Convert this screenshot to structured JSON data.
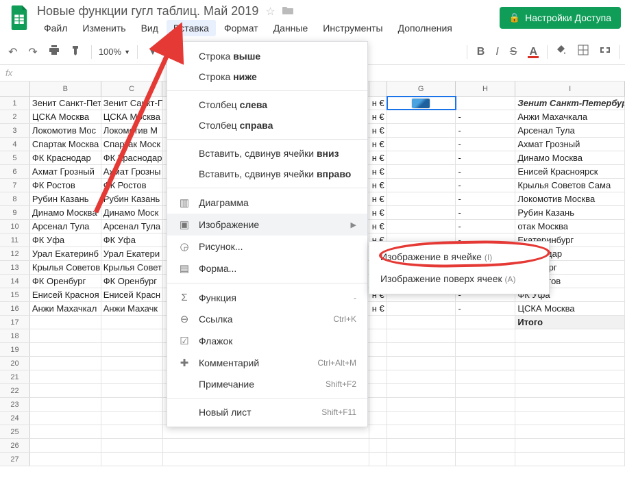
{
  "doc": {
    "title": "Новые функции гугл таблиц. Май 2019"
  },
  "menus": {
    "file": "Файл",
    "edit": "Изменить",
    "view": "Вид",
    "insert": "Вставка",
    "format": "Формат",
    "data": "Данные",
    "tools": "Инструменты",
    "addons": "Дополнения"
  },
  "share": {
    "label": "Настройки Доступа"
  },
  "toolbar": {
    "zoom": "100%",
    "bold": "B",
    "italic": "I",
    "strike": "S",
    "textcolor": "A"
  },
  "fx": {
    "label": "fx"
  },
  "columns": {
    "B": "B",
    "C": "C",
    "G": "G",
    "H": "H",
    "I": "I"
  },
  "insert_menu": {
    "row_above": {
      "pre": "Строка ",
      "b": "выше"
    },
    "row_below": {
      "pre": "Строка ",
      "b": "ниже"
    },
    "col_left": {
      "pre": "Столбец ",
      "b": "слева"
    },
    "col_right": {
      "pre": "Столбец ",
      "b": "справа"
    },
    "cells_down": {
      "pre": "Вставить, сдвинув ячейки ",
      "b": "вниз"
    },
    "cells_right": {
      "pre": "Вставить, сдвинув ячейки ",
      "b": "вправо"
    },
    "chart": "Диаграмма",
    "image": "Изображение",
    "drawing": "Рисунок...",
    "form": "Форма...",
    "function": "Функция",
    "function_sc": "-",
    "link": "Ссылка",
    "link_sc": "Ctrl+K",
    "checkbox": "Флажок",
    "comment": "Комментарий",
    "comment_sc": "Ctrl+Alt+M",
    "note": "Примечание",
    "note_sc": "Shift+F2",
    "sheet": "Новый лист",
    "sheet_sc": "Shift+F11"
  },
  "image_submenu": {
    "in_cell": "Изображение в ячейке",
    "in_cell_kb": "(I)",
    "over_cells": "Изображение поверх ячеек",
    "over_cells_kb": "(A)"
  },
  "col_b": [
    "Зенит Санкт-Пет",
    "ЦСКА Москва",
    "Локомотив Мос",
    "Спартак Москва",
    "ФК Краснодар",
    "Ахмат Грозный",
    "ФК Ростов",
    "Рубин Казань",
    "Динамо Москва",
    "Арсенал Тула",
    "ФК Уфа",
    "Урал Екатеринб",
    "Крылья Советов",
    "ФК Оренбург",
    "Енисей Красноя",
    "Анжи Махачкал"
  ],
  "col_c": [
    "Зенит Санкт-П",
    "ЦСКА Москва",
    "Локомотив М",
    "Спартак Моск",
    "ФК Краснодар",
    "Ахмат Грозны",
    "ФК Ростов",
    "Рубин Казань",
    "Динамо Моск",
    "Арсенал Тула",
    "ФК Уфа",
    "Урал Екатери",
    "Крылья Совет",
    "ФК Оренбург",
    "Енисей Красн",
    "Анжи Махачк"
  ],
  "col_e_suffix": "н €",
  "col_h_dash": "-",
  "col_i": [
    "Зенит Санкт-Петербург",
    "Анжи Махачкала",
    "Арсенал Тула",
    "Ахмат Грозный",
    "Динамо Москва",
    "Енисей Красноярск",
    "Крылья Советов Сама",
    "Локомотив Москва",
    "Рубин Казань",
    "отак Москва",
    "Екатеринбург",
    "Краснодар",
    "Оренбург",
    "ФК Ростов",
    "ФК Уфа",
    "ЦСКА Москва",
    "Итого"
  ]
}
